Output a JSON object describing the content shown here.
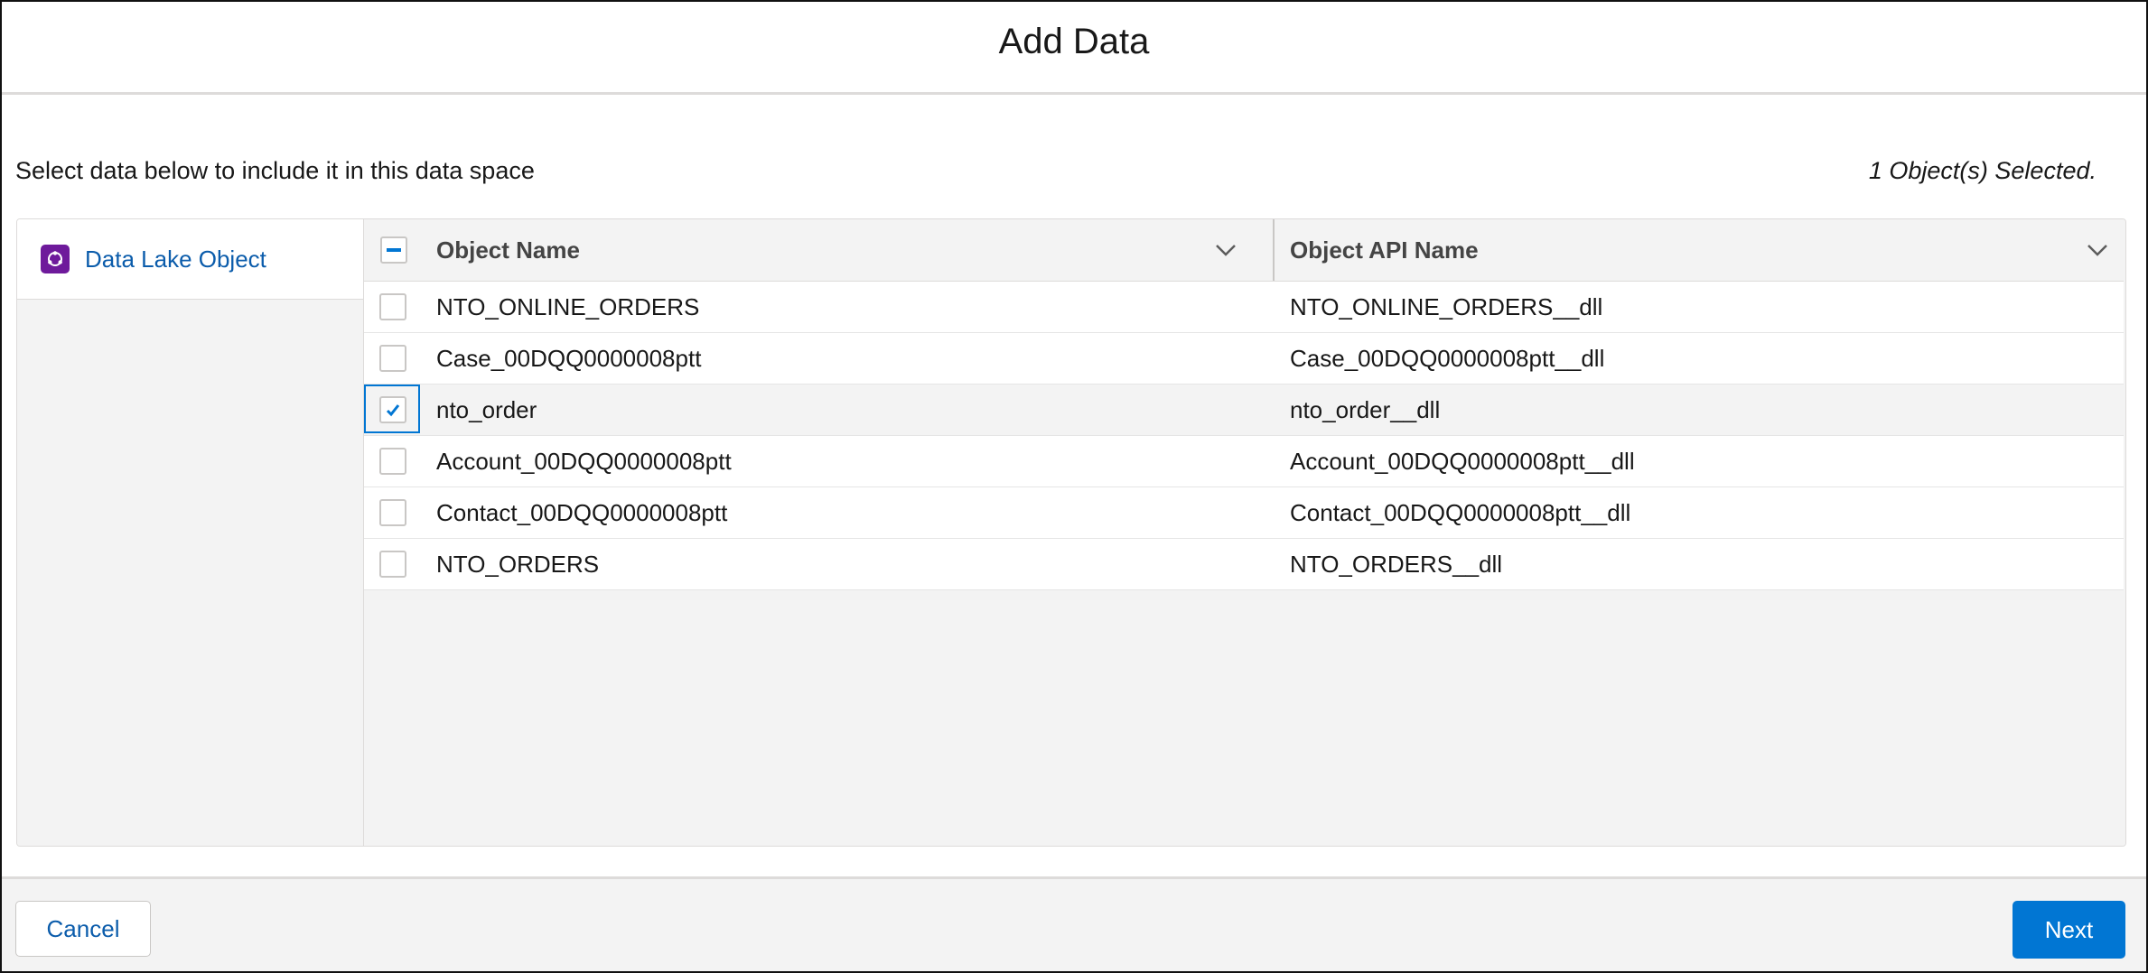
{
  "modal": {
    "title": "Add Data",
    "instructions": "Select data below to include it in this data space",
    "selected_count_text": "1 Object(s) Selected."
  },
  "sidebar": {
    "items": [
      {
        "label": "Data Lake Object",
        "icon": "data-lake-object-icon",
        "icon_color": "#6e1a9b",
        "active": true
      }
    ]
  },
  "table": {
    "header_checkbox_state": "indeterminate",
    "columns": [
      {
        "label": "Object Name",
        "icon": "chevron-down-icon"
      },
      {
        "label": "Object API Name",
        "icon": "chevron-down-icon"
      }
    ],
    "rows": [
      {
        "object_name": "NTO_ONLINE_ORDERS",
        "api_name": "NTO_ONLINE_ORDERS__dll",
        "checked": false
      },
      {
        "object_name": "Case_00DQQ0000008ptt",
        "api_name": "Case_00DQQ0000008ptt__dll",
        "checked": false
      },
      {
        "object_name": "nto_order",
        "api_name": "nto_order__dll",
        "checked": true
      },
      {
        "object_name": "Account_00DQQ0000008ptt",
        "api_name": "Account_00DQQ0000008ptt__dll",
        "checked": false
      },
      {
        "object_name": "Contact_00DQQ0000008ptt",
        "api_name": "Contact_00DQQ0000008ptt__dll",
        "checked": false
      },
      {
        "object_name": "NTO_ORDERS",
        "api_name": "NTO_ORDERS__dll",
        "checked": false
      }
    ]
  },
  "footer": {
    "cancel_label": "Cancel",
    "next_label": "Next"
  },
  "colors": {
    "brand": "#0176d3",
    "link": "#0b5cab",
    "dlo_icon_bg": "#6e1a9b"
  }
}
